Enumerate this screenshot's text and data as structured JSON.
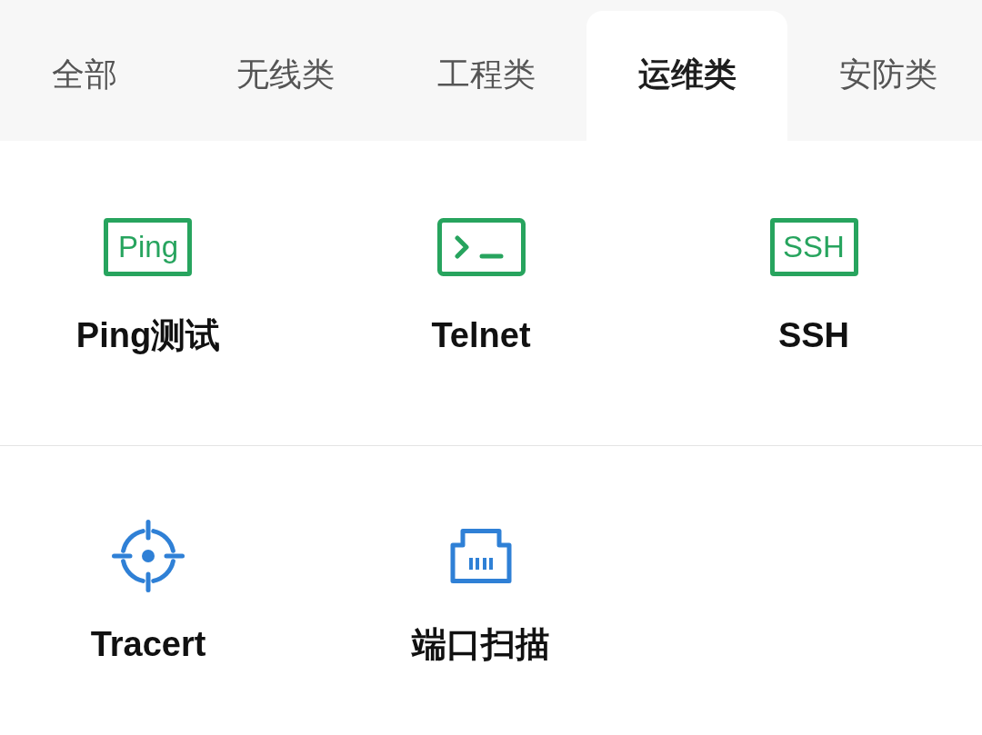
{
  "tabs": [
    {
      "label": "全部",
      "selected": false
    },
    {
      "label": "无线类",
      "selected": false
    },
    {
      "label": "工程类",
      "selected": false
    },
    {
      "label": "运维类",
      "selected": true
    },
    {
      "label": "安防类",
      "selected": false
    }
  ],
  "tool_rows": [
    {
      "tools": [
        {
          "kind": "text_box",
          "icon_text": "Ping",
          "label": "Ping测试",
          "color": "#27a45e"
        },
        {
          "kind": "terminal",
          "label": "Telnet",
          "color": "#27a45e"
        },
        {
          "kind": "text_box",
          "icon_text": "SSH",
          "label": "SSH",
          "color": "#27a45e"
        }
      ]
    },
    {
      "tools": [
        {
          "kind": "crosshair",
          "label": "Tracert",
          "color": "#2f80d6"
        },
        {
          "kind": "ethernet_port",
          "label": "端口扫描",
          "color": "#2f80d6"
        }
      ]
    }
  ]
}
